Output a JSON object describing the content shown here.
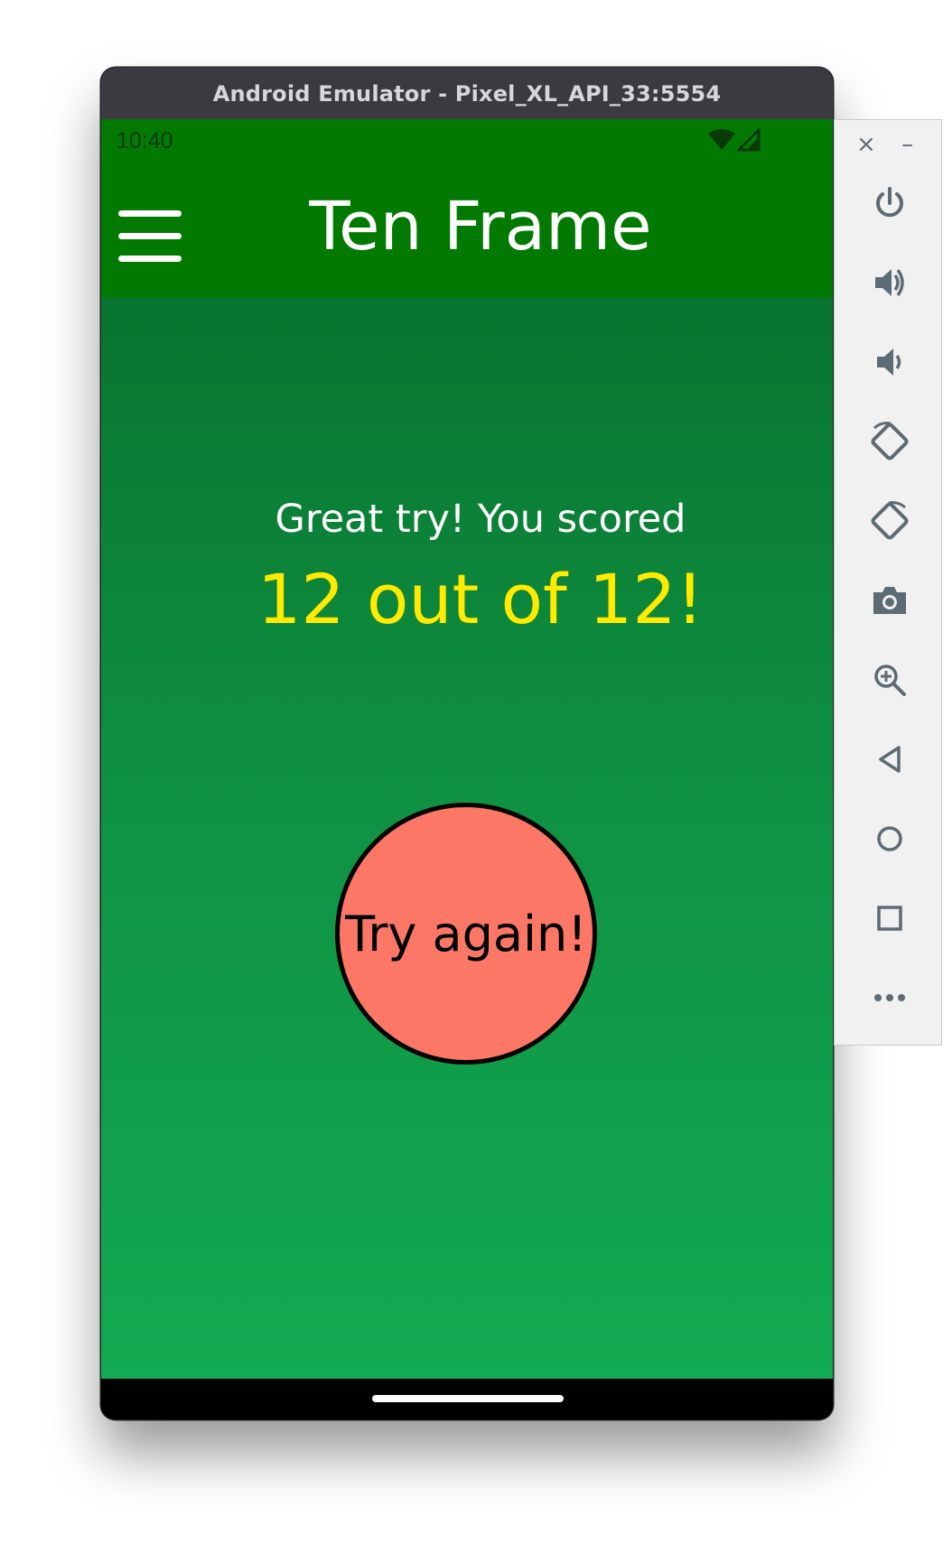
{
  "window": {
    "title": "Android Emulator - Pixel_XL_API_33:5554"
  },
  "status_bar": {
    "time": "10:40"
  },
  "app": {
    "title": "Ten Frame",
    "score_label": "Great try! You scored",
    "score_value": "12 out of 12!",
    "try_again_label": "Try again!"
  },
  "toolbar": {
    "close_glyph": "×",
    "minimize_glyph": "–",
    "buttons": [
      {
        "icon": "power-icon"
      },
      {
        "icon": "volume-up-icon"
      },
      {
        "icon": "volume-down-icon"
      },
      {
        "icon": "rotate-left-icon"
      },
      {
        "icon": "rotate-right-icon"
      },
      {
        "icon": "camera-icon"
      },
      {
        "icon": "zoom-icon"
      },
      {
        "icon": "back-icon"
      },
      {
        "icon": "home-icon"
      },
      {
        "icon": "overview-icon"
      },
      {
        "icon": "more-icon"
      }
    ]
  },
  "colors": {
    "app_bar": "#027a02",
    "background_top": "#066a28",
    "background_bottom": "#12aa52",
    "score_value": "#ffea00",
    "try_again_button": "#fd7766",
    "toolbar_icon": "#5d6b74"
  }
}
